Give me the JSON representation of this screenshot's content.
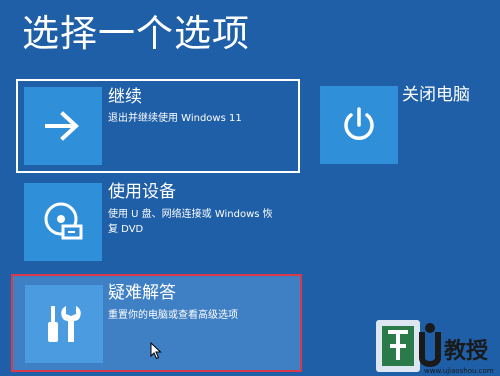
{
  "page": {
    "title": "选择一个选项"
  },
  "options": {
    "continue": {
      "title": "继续",
      "desc": "退出并继续使用 Windows 11",
      "icon": "arrow-right-icon"
    },
    "use_device": {
      "title": "使用设备",
      "desc": "使用 U 盘、网络连接或 Windows 恢复 DVD",
      "icon": "disc-drive-icon"
    },
    "troubleshoot": {
      "title": "疑难解答",
      "desc": "重置你的电脑或查看高级选项",
      "icon": "tools-icon"
    },
    "shutdown": {
      "title": "关闭电脑",
      "icon": "power-icon"
    }
  },
  "watermark": {
    "brand": "U教授",
    "url": "www.ujiaoshou.com"
  },
  "colors": {
    "background": "#1f5fa8",
    "tile": "#2f8fd8",
    "highlight_border": "#d9394a"
  }
}
